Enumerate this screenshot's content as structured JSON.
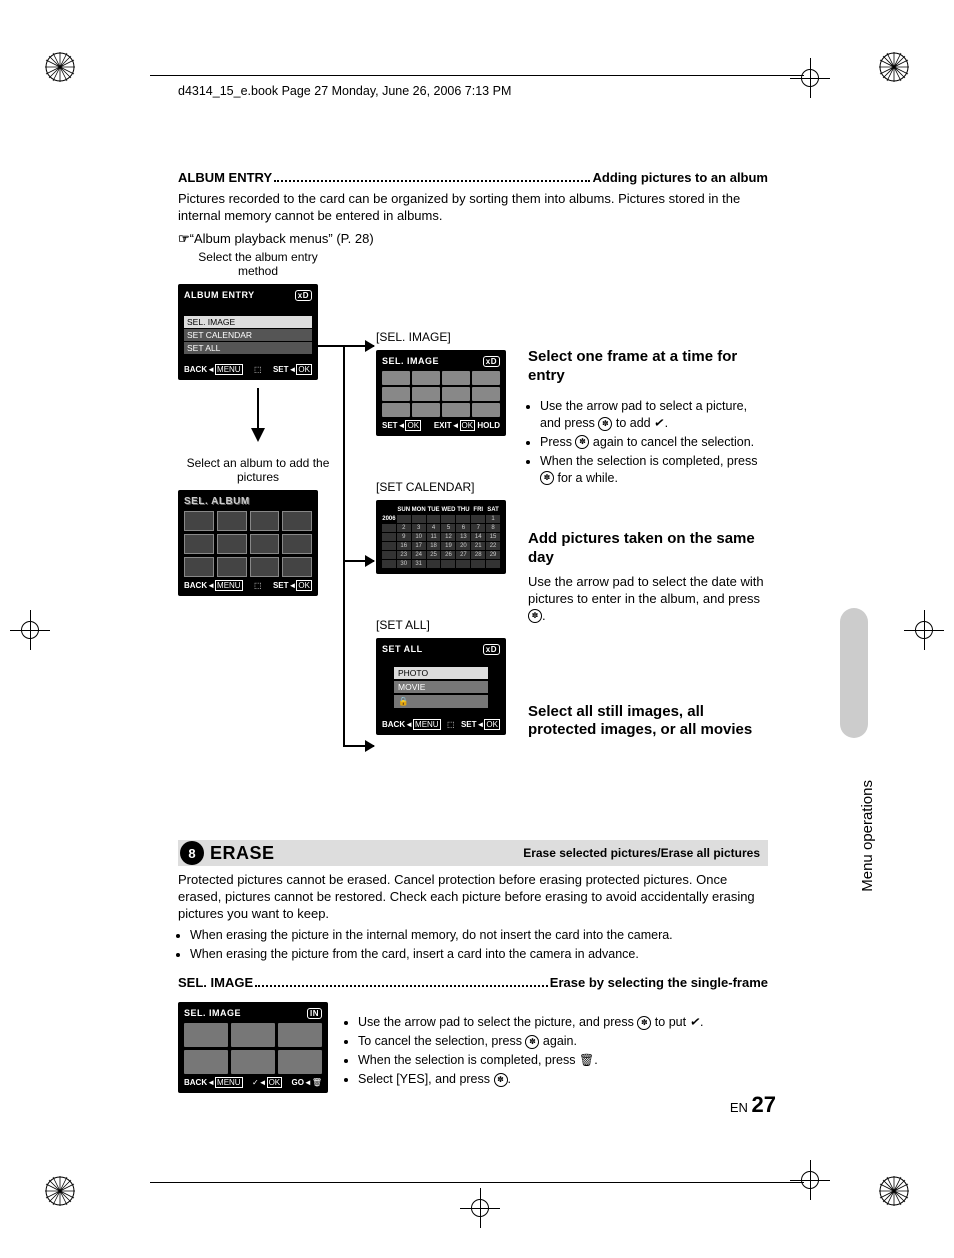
{
  "header": "d4314_15_e.book  Page 27  Monday, June 26, 2006  7:13 PM",
  "album_entry": {
    "lead": "ALBUM ENTRY",
    "tail": "Adding pictures to an album",
    "para": "Pictures recorded to the card can be organized by sorting them into albums. Pictures stored in the internal memory cannot be entered in albums.",
    "ref": "“Album playback menus” (P. 28)"
  },
  "captions": {
    "method": "Select the album entry method",
    "select_album": "Select an album to add the pictures",
    "sel_image": "[SEL. IMAGE]",
    "set_calendar": "[SET CALENDAR]",
    "set_all": "[SET ALL]"
  },
  "lcd": {
    "album_entry_title": "ALBUM ENTRY",
    "xd": "xD",
    "opt1": "SEL. IMAGE",
    "opt2": "SET CALENDAR",
    "opt3": "SET ALL",
    "back": "BACK",
    "menu": "MENU",
    "set": "SET",
    "ok": "OK",
    "sel_album_title": "SEL. ALBUM",
    "sel_image_title": "SEL. IMAGE",
    "exit": "EXIT",
    "hold": "HOLD",
    "set_all_title": "SET ALL",
    "photo": "PHOTO",
    "movie": "MOVIE",
    "in": "IN",
    "go": "GO",
    "cal_year": "2006",
    "cal_days": [
      "SUN",
      "MON",
      "TUE",
      "WED",
      "THU",
      "FRI",
      "SAT"
    ]
  },
  "right": {
    "h1": "Select one frame at a time for entry",
    "b1a": "Use the arrow pad to select a picture, and press ",
    "b1b": " to add ",
    "b1c": ".",
    "b2a": "Press ",
    "b2b": " again to cancel the selection.",
    "b3a": "When the selection is completed, press ",
    "b3b": " for a while.",
    "h2": "Add pictures taken on the same day",
    "p2a": "Use the arrow pad to select the date with pictures to enter in the album, and press ",
    "p2b": ".",
    "h3": "Select all still images, all protected images, or all movies"
  },
  "erase": {
    "num": "8",
    "title": "ERASE",
    "sub": "Erase selected pictures/Erase all pictures",
    "para": "Protected pictures cannot be erased. Cancel protection before erasing protected pictures. Once erased, pictures cannot be restored. Check each picture before erasing to avoid accidentally erasing pictures you want to keep.",
    "b1": "When erasing the picture in the internal memory, do not insert the card into the camera.",
    "b2": "When erasing the picture from the card, insert a card into the camera in advance.",
    "sel_lead": "SEL. IMAGE",
    "sel_tail": "Erase by selecting the single-frame",
    "eb1a": "Use the arrow pad to select the picture, and press ",
    "eb1b": " to put ",
    "eb1c": ".",
    "eb2a": "To cancel the selection, press ",
    "eb2b": " again.",
    "eb3a": "When the selection is completed, press ",
    "eb3b": ".",
    "eb4a": "Select [YES], and press ",
    "eb4b": "."
  },
  "side": "Menu operations",
  "page_en": "EN",
  "page_num": "27"
}
